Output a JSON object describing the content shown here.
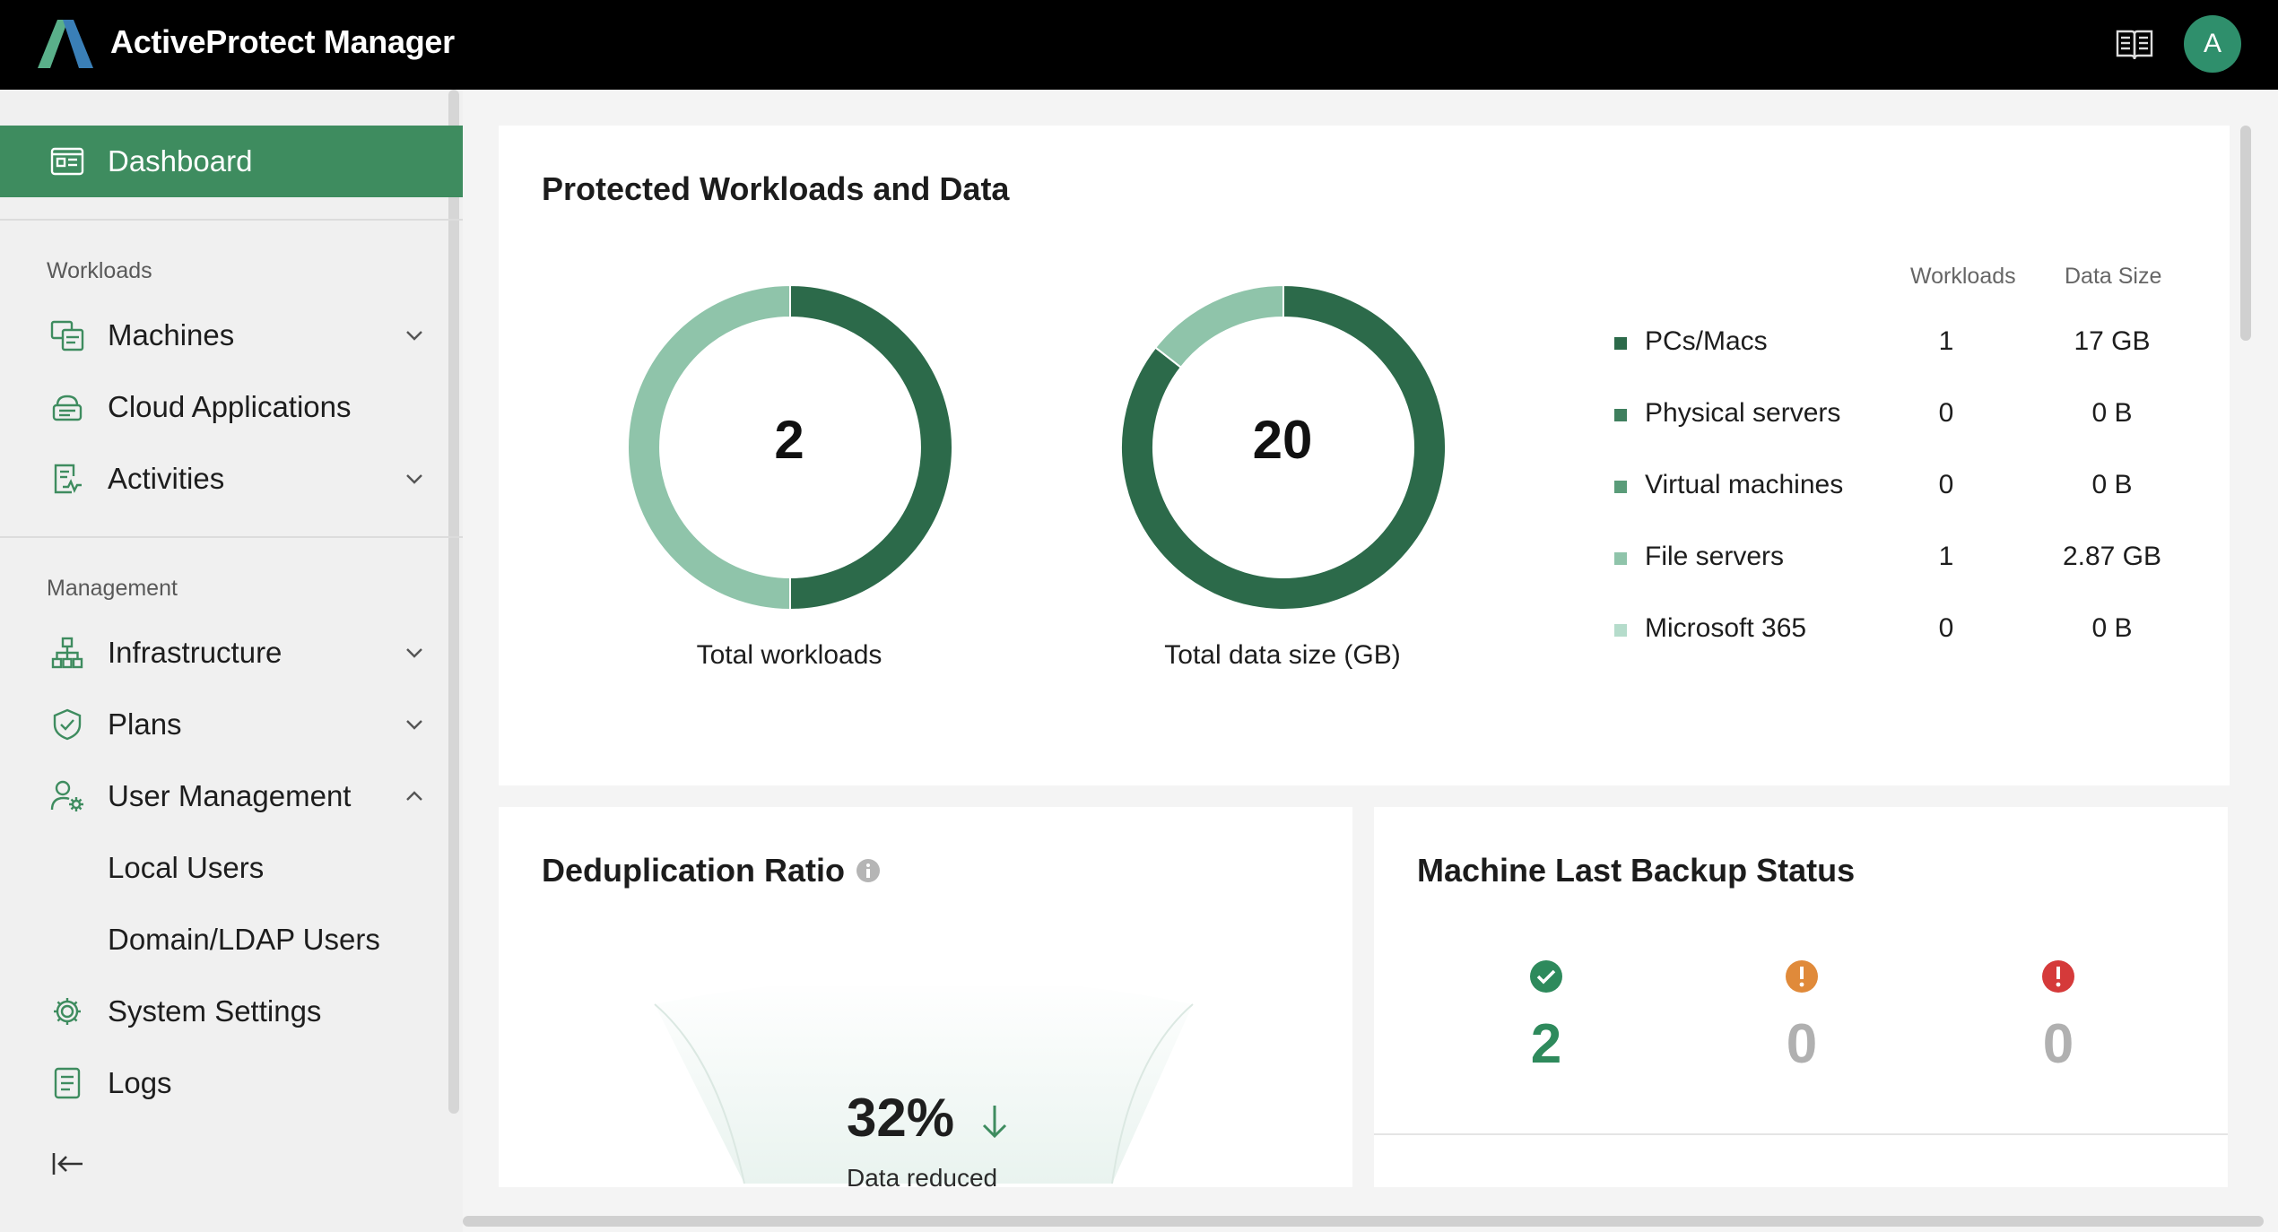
{
  "app": {
    "title": "ActiveProtect Manager",
    "user_initial": "A"
  },
  "colors": {
    "accent": "#3e8c5f",
    "dark_green": "#2c6a4a",
    "light_green": "#8fc4aa"
  },
  "sidebar": {
    "dashboard": "Dashboard",
    "sections": {
      "workloads": "Workloads",
      "management": "Management"
    },
    "items": {
      "machines": "Machines",
      "cloud_apps": "Cloud Applications",
      "activities": "Activities",
      "infrastructure": "Infrastructure",
      "plans": "Plans",
      "user_management": "User Management",
      "local_users": "Local Users",
      "domain_users": "Domain/LDAP Users",
      "system_settings": "System Settings",
      "logs": "Logs"
    }
  },
  "protected": {
    "title": "Protected Workloads and Data",
    "total_workloads": "2",
    "total_workloads_label": "Total workloads",
    "total_data": "20",
    "total_data_label": "Total data size (GB)",
    "columns": {
      "workloads": "Workloads",
      "data_size": "Data Size"
    },
    "rows": [
      {
        "name": "PCs/Macs",
        "workloads": "1",
        "size": "17 GB",
        "color": "#2c6a4a"
      },
      {
        "name": "Physical servers",
        "workloads": "0",
        "size": "0 B",
        "color": "#3f7f5e"
      },
      {
        "name": "Virtual machines",
        "workloads": "0",
        "size": "0 B",
        "color": "#5a9c79"
      },
      {
        "name": "File servers",
        "workloads": "1",
        "size": "2.87 GB",
        "color": "#8fc4aa"
      },
      {
        "name": "Microsoft 365",
        "workloads": "0",
        "size": "0 B",
        "color": "#b5dccb"
      }
    ]
  },
  "chart_data": [
    {
      "type": "pie",
      "categories": [
        "PCs/Macs",
        "File servers"
      ],
      "values": [
        1,
        1
      ]
    },
    {
      "type": "pie",
      "categories": [
        "PCs/Macs",
        "File servers"
      ],
      "values": [
        17,
        2.87
      ]
    }
  ],
  "dedup": {
    "title": "Deduplication Ratio",
    "value": "32%",
    "caption": "Data reduced"
  },
  "backup_status": {
    "title": "Machine Last Backup Status",
    "success": "2",
    "warning": "0",
    "error": "0"
  }
}
